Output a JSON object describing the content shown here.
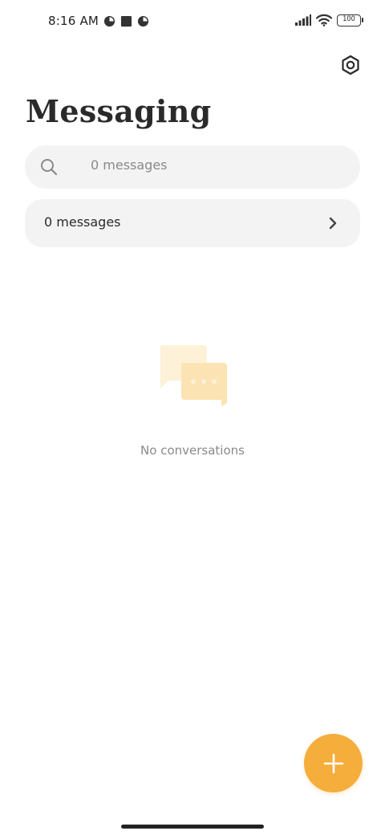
{
  "status_bar": {
    "time": "8:16 AM",
    "notification_icons": [
      "pie-chart-icon",
      "square-app-icon",
      "pie-chart-icon"
    ],
    "signal_icon": "signal-bars-icon",
    "wifi_icon": "wifi-icon",
    "battery_level": "100"
  },
  "header": {
    "settings_icon": "settings-hexagon-icon",
    "title": "Messaging"
  },
  "search": {
    "placeholder": "0 messages",
    "icon": "search-icon"
  },
  "messages_row": {
    "label": "0 messages",
    "chevron_icon": "chevron-right-icon"
  },
  "empty_state": {
    "illustration_icon": "chat-bubbles-icon",
    "text": "No conversations"
  },
  "fab": {
    "icon": "plus-icon"
  },
  "colors": {
    "accent": "#f5ad3c",
    "surface": "#f3f3f3",
    "text_primary": "#2a2a2a",
    "text_secondary": "#8a8a8a",
    "illustration_light": "#fdf1d8",
    "illustration_dark": "#fbe3b3"
  }
}
